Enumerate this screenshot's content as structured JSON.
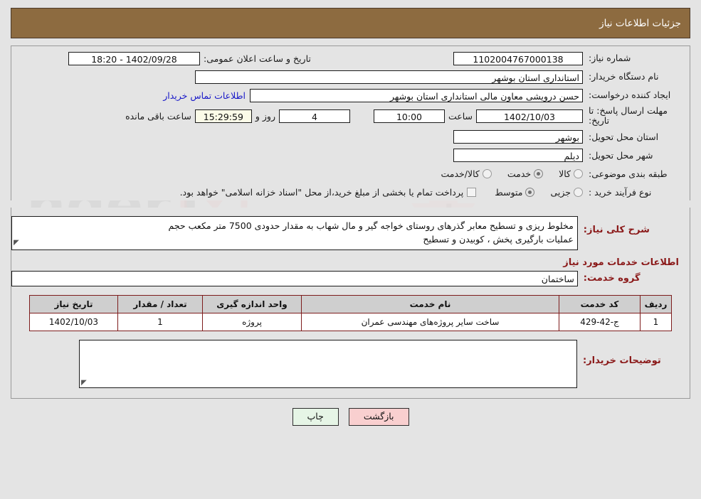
{
  "header": {
    "title": "جزئیات اطلاعات نیاز"
  },
  "fields": {
    "need_number_label": "شماره نیاز:",
    "need_number_value": "1102004767000138",
    "buyer_org_label": "نام دستگاه خریدار:",
    "buyer_org_value": "استانداری استان بوشهر",
    "creator_label": "ایجاد کننده درخواست:",
    "creator_value": "حسن درویشی معاون مالی استانداری استان بوشهر",
    "deadline_label": "مهلت ارسال پاسخ: تا تاریخ:",
    "deadline_date": "1402/10/03",
    "hour_label": "ساعت",
    "deadline_time": "10:00",
    "days_value": "4",
    "days_word": "روز و",
    "countdown": "15:29:59",
    "remaining_word": "ساعت باقی مانده",
    "announce_label": "تاریخ و ساعت اعلان عمومی:",
    "announce_value": "1402/09/28 - 18:20",
    "contact_link": "اطلاعات تماس خریدار",
    "province_label": "استان محل تحویل:",
    "province_value": "بوشهر",
    "city_label": "شهر محل تحویل:",
    "city_value": "دیلم",
    "category_label": "طبقه بندی موضوعی:",
    "purchase_type_label": "نوع فرآیند خرید :",
    "treasury_note": "پرداخت تمام یا بخشی از مبلغ خرید،از محل \"اسناد خزانه اسلامی\" خواهد بود."
  },
  "category_options": [
    {
      "label": "کالا",
      "selected": false
    },
    {
      "label": "خدمت",
      "selected": true
    },
    {
      "label": "کالا/خدمت",
      "selected": false
    }
  ],
  "purchase_options": [
    {
      "label": "جزیی",
      "selected": false
    },
    {
      "label": "متوسط",
      "selected": true
    }
  ],
  "treasury_checked": false,
  "description": {
    "label": "شرح کلی نیاز:",
    "line1": "مخلوط ریزی و تسطیح معابر  گذرهای روستای خواجه گیر و مال شهاب به مقدار حدودی 7500 متر مکعب حجم",
    "line2": "عملیات بارگیری پخش ، کوبیدن  و تسطیح"
  },
  "services_section": {
    "heading": "اطلاعات خدمات مورد نیاز",
    "group_label": "گروه خدمت:",
    "group_value": "ساختمان"
  },
  "table": {
    "columns": [
      "ردیف",
      "کد خدمت",
      "نام خدمت",
      "واحد اندازه گیری",
      "تعداد / مقدار",
      "تاریخ نیاز"
    ],
    "rows": [
      [
        "1",
        "ج-42-429",
        "ساخت سایر پروژه‌های مهندسی عمران",
        "پروژه",
        "1",
        "1402/10/03"
      ]
    ]
  },
  "notes": {
    "label": "توضیحات خریدار:",
    "value": ""
  },
  "buttons": {
    "print": "چاپ",
    "back": "بازگشت"
  },
  "colors": {
    "header_bg": "#8d6b40",
    "section_label": "#8b1a1a",
    "link": "#1818c8",
    "table_border": "#7d1c1c",
    "countdown_bg": "#fbfbe8"
  }
}
